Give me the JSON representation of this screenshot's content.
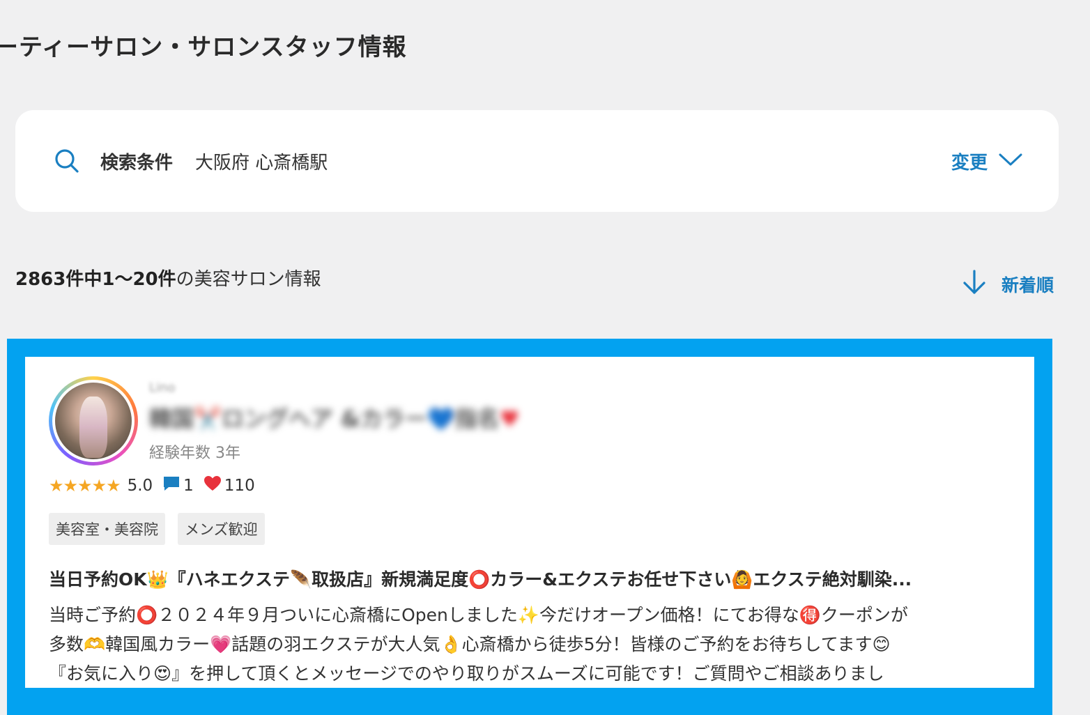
{
  "page": {
    "title": "ーティーサロン・サロンスタッフ情報"
  },
  "search": {
    "label": "検索条件",
    "value": "大阪府 心斎橋駅",
    "change_label": "変更"
  },
  "results": {
    "count_bold": "2863件中1〜20件",
    "count_suffix": "の美容サロン情報",
    "sort_label": "新着順"
  },
  "card": {
    "experience": "経験年数 3年",
    "stars": "★★★★★",
    "rating": "5.0",
    "comments": "1",
    "likes": "110",
    "tags": [
      "美容室・美容院",
      "メンズ歓迎"
    ],
    "catchphrase": "当日予約OK👑『ハネエクステ🪶取扱店』新規満足度⭕カラー&エクステお任せ下さい🙆エクステ絶対馴染...",
    "description_line1": "当時ご予約⭕２０２４年９月ついに心斎橋にOpenしました✨今だけオープン価格！にてお得な🉐クーポンが",
    "description_line2": "多数🫶韓国風カラー💗話題の羽エクステが大人気👌心斎橋から徒歩5分！皆様のご予約をお待ちしてます😊",
    "description_line3": "『お気に入り😍』を押して頂くとメッセージでのやり取りがスムーズに可能です！ご質問やご相談ありまし"
  },
  "colors": {
    "accent": "#1a7fc1",
    "highlight_frame": "#03a2f0",
    "star": "#f5a623",
    "comment_icon": "#1a7fc1",
    "heart_icon": "#e8323c"
  }
}
